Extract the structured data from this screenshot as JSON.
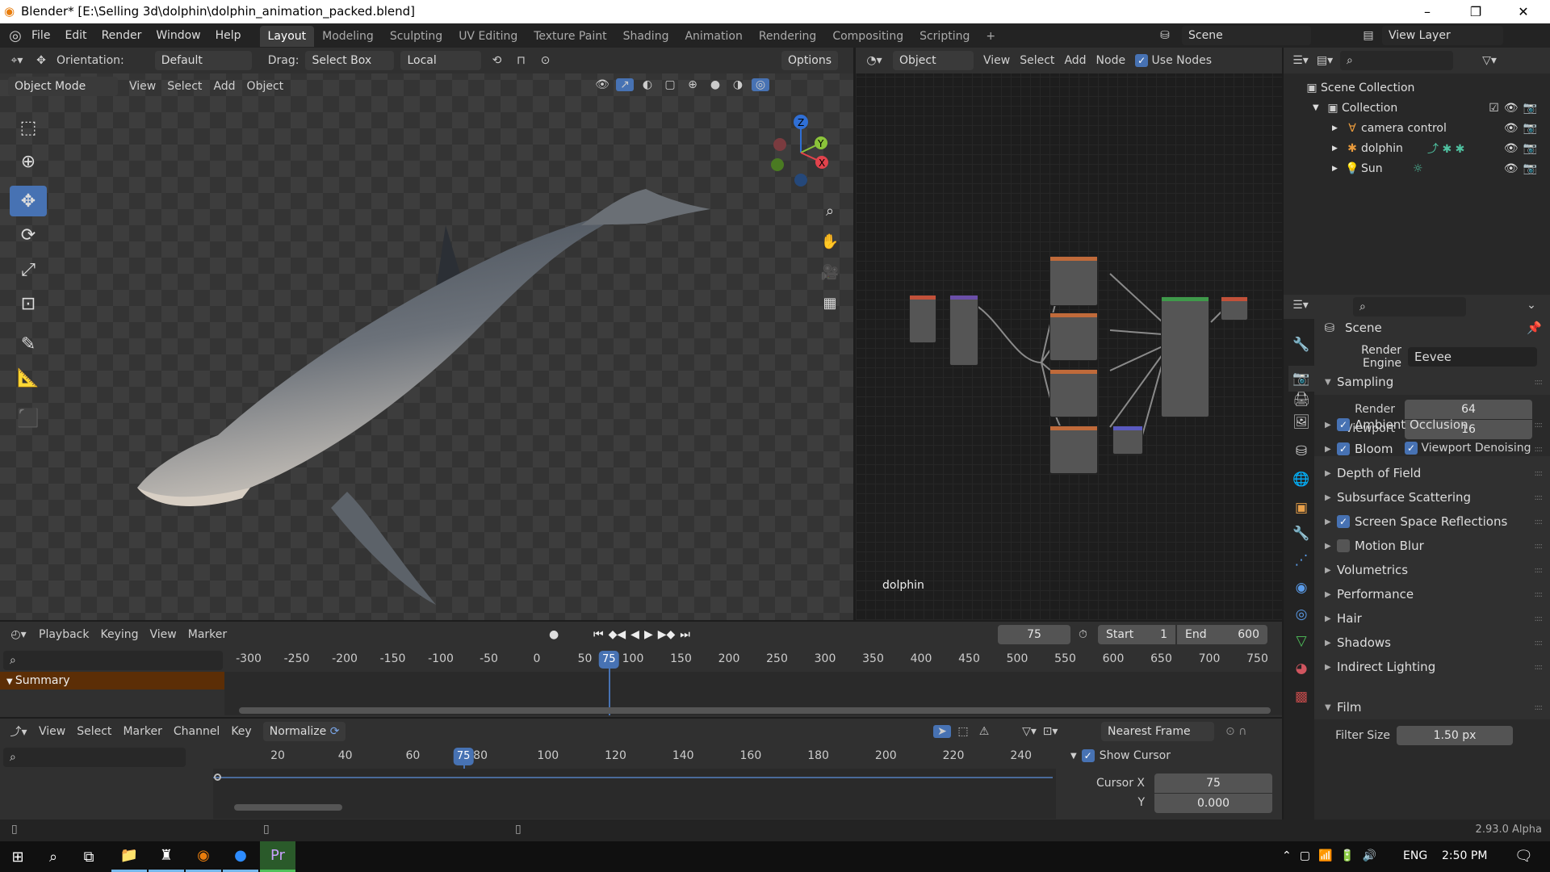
{
  "window": {
    "title": "Blender* [E:\\Selling 3d\\dolphin\\dolphin_animation_packed.blend]",
    "minimize": "–",
    "maximize": "❐",
    "close": "✕"
  },
  "menu": [
    "File",
    "Edit",
    "Render",
    "Window",
    "Help"
  ],
  "workspaces": [
    "Layout",
    "Modeling",
    "Sculpting",
    "UV Editing",
    "Texture Paint",
    "Shading",
    "Animation",
    "Rendering",
    "Compositing",
    "Scripting",
    "+"
  ],
  "scene": "Scene",
  "view_layer": "View Layer",
  "viewport": {
    "orientation_label": "Orientation:",
    "orientation": "Default",
    "drag_label": "Drag:",
    "drag": "Select Box",
    "pivot": "Local",
    "options": "Options",
    "mode": "Object Mode",
    "menus": [
      "View",
      "Select",
      "Add",
      "Object"
    ],
    "gizmo": {
      "x": "X",
      "y": "Y",
      "z": "Z"
    }
  },
  "node_editor": {
    "type": "Object",
    "menus": [
      "View",
      "Select",
      "Add",
      "Node"
    ],
    "use_nodes": "Use Nodes",
    "material_label": "dolphin"
  },
  "outliner": {
    "root": "Scene Collection",
    "collection": "Collection",
    "items": [
      "camera control",
      "dolphin",
      "Sun"
    ]
  },
  "properties": {
    "context": "Scene",
    "render_engine_label": "Render Engine",
    "render_engine": "Eevee",
    "sampling": {
      "title": "Sampling",
      "render_label": "Render",
      "render": "64",
      "viewport_label": "Viewport",
      "viewport": "16",
      "denoise": "Viewport Denoising"
    },
    "panels": [
      {
        "label": "Ambient Occlusion",
        "checkbox": true,
        "checked": true
      },
      {
        "label": "Bloom",
        "checkbox": true,
        "checked": true
      },
      {
        "label": "Depth of Field",
        "checkbox": false
      },
      {
        "label": "Subsurface Scattering",
        "checkbox": false
      },
      {
        "label": "Screen Space Reflections",
        "checkbox": true,
        "checked": true
      },
      {
        "label": "Motion Blur",
        "checkbox": true,
        "checked": false
      },
      {
        "label": "Volumetrics",
        "checkbox": false
      },
      {
        "label": "Performance",
        "checkbox": false
      },
      {
        "label": "Hair",
        "checkbox": false
      },
      {
        "label": "Shadows",
        "checkbox": false
      },
      {
        "label": "Indirect Lighting",
        "checkbox": false
      }
    ],
    "film": {
      "title": "Film",
      "filter_label": "Filter Size",
      "filter": "1.50 px"
    }
  },
  "timeline": {
    "menus": [
      "Playback",
      "Keying",
      "View",
      "Marker"
    ],
    "current_frame": "75",
    "start_label": "Start",
    "start": "1",
    "end_label": "End",
    "end": "600",
    "ticks": [
      "-300",
      "-250",
      "-200",
      "-150",
      "-100",
      "-50",
      "0",
      "50",
      "100",
      "150",
      "200",
      "250",
      "300",
      "350",
      "400",
      "450",
      "500",
      "550",
      "600",
      "650",
      "700",
      "750"
    ],
    "summary": "Summary"
  },
  "graph": {
    "menus": [
      "View",
      "Select",
      "Marker",
      "Channel",
      "Key"
    ],
    "normalize": "Normalize",
    "snap": "Nearest Frame",
    "ticks": [
      "20",
      "40",
      "60",
      "80",
      "100",
      "120",
      "140",
      "160",
      "180",
      "200",
      "220",
      "240"
    ],
    "current_frame": "75",
    "show_cursor": "Show Cursor",
    "cursor_x_label": "Cursor X",
    "cursor_x": "75",
    "cursor_y_label": "Y",
    "cursor_y": "0.000"
  },
  "status": {
    "version": "2.93.0 Alpha"
  },
  "taskbar": {
    "lang": "ENG",
    "time": "2:50 PM"
  }
}
